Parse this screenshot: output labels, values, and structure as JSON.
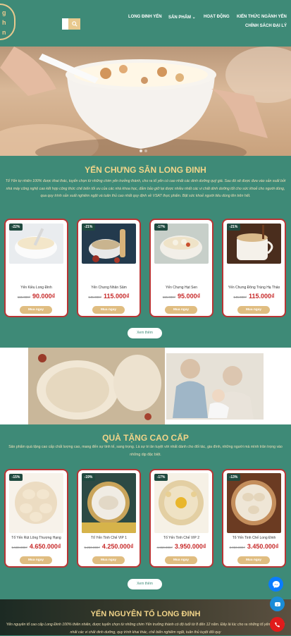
{
  "header": {
    "logo_lines": [
      "g",
      "h",
      "n"
    ],
    "search_icon": "search-icon",
    "nav": [
      "LONG ĐINH YẾN",
      "SẢN PHẨM",
      "HOẠT ĐỘNG",
      "KIẾN THỨC NGÀNH YẾN",
      "CHÍNH SÁCH ĐẠI LÝ"
    ]
  },
  "section1": {
    "title": "YẾN CHƯNG SẴN LONG ĐINH",
    "desc": "Tổ Yến tự nhiên 100% được khai thác, tuyển chọn từ những chim yến trưởng thành, cho ra tổ yến có cao nhất các dinh dưỡng quý giá. Sau đó sẽ được đưa vào sản xuất bởi nhà máy công nghệ cao kết hợp công thức chế biến tối ưu của các nhà khoa học, đảm bảo giữ lại được nhiều nhất các vi chất dinh dưỡng tốt cho sức khoẻ cho người dùng, qua quy trình sản xuất nghiêm ngặt và tuân thủ cao nhất quy định về VSAT thực phẩm. Bật sức khoẻ người tiêu dùng lên trên hết.",
    "products": [
      {
        "badge": "-22%",
        "name": "Yến Kiều Long Đinh",
        "old": "115.000₫",
        "price": "90.000₫",
        "buy": "Mua ngay"
      },
      {
        "badge": "-21%",
        "name": "Yến Chưng Nhân Sâm",
        "old": "145.000₫",
        "price": "115.000₫",
        "buy": "Mua ngay"
      },
      {
        "badge": "-17%",
        "name": "Yến Chưng Hạt Sen",
        "old": "115.000₫",
        "price": "95.000₫",
        "buy": "Mua ngay"
      },
      {
        "badge": "-21%",
        "name": "Yến Chưng Đông Trùng Hạ Thảo",
        "old": "145.000₫",
        "price": "115.000₫",
        "buy": "Mua ngay"
      }
    ],
    "more": "Xem thêm"
  },
  "section3": {
    "title": "QUÀ TẶNG CAO CẤP",
    "desc": "Sản phẩm quà tặng cao cấp chất lượng cao, mang đến sự tinh tế, sang trọng. Là sự tri ân tuyệt vời nhất dành cho đối tác, gia đình, những người mà mình trân trọng vào những dịp đặc biệt.",
    "products": [
      {
        "badge": "-15%",
        "name": "Tổ Yến Rút Lông Thượng Hạng",
        "old": "5.500.000₫",
        "price": "4.650.000₫",
        "buy": "Mua ngay"
      },
      {
        "badge": "-19%",
        "name": "Tổ Yến Tinh Chế VIP 1",
        "old": "5.250.000₫",
        "price": "4.250.000₫",
        "buy": "Mua ngay"
      },
      {
        "badge": "-17%",
        "name": "Tổ Yến Tinh Chế VIP 2",
        "old": "4.650.000₫",
        "price": "3.950.000₫",
        "buy": "Mua ngay"
      },
      {
        "badge": "-13%",
        "name": "Tổ Yến Tinh Chế Long Đinh",
        "old": "3.950.000₫",
        "price": "3.450.000₫",
        "buy": "Mua ngay"
      }
    ],
    "more": "Xem thêm"
  },
  "section4": {
    "title": "YẾN NGUYÊN TỔ LONG ĐINH",
    "desc": "Yến nguyên tổ cao cấp Long Đinh 100% thiên nhiên, được tuyển chọn từ những chim Yến trưởng thành có độ tuổi từ 8 đến 12 năm. Đây là lúc cho ra những tổ yến có nhiều nhất các vi chất dinh dưỡng, quy trình khai thác, chế biến nghiêm ngặt, tuân thủ tuyệt đối quy"
  },
  "fabs": [
    "messenger-icon",
    "zalo-icon",
    "phone-icon"
  ],
  "colors": {
    "brand": "#3e8a77",
    "gold": "#f1d489",
    "red": "#c72a2a",
    "button": "#e0bd81"
  }
}
